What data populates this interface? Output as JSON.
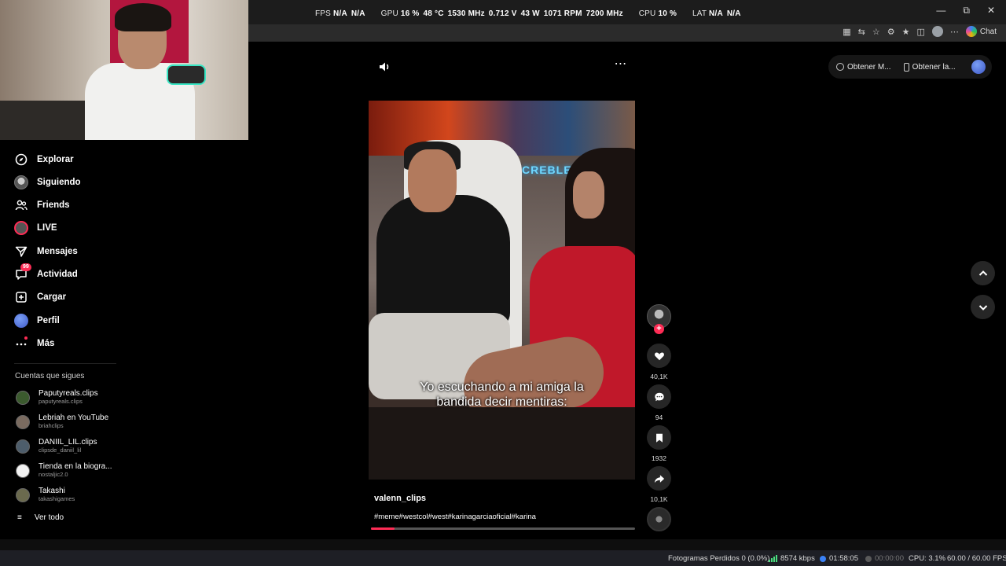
{
  "osd": {
    "fps_label": "FPS",
    "fps_val1": "N/A",
    "fps_val2": "N/A",
    "gpu_label": "GPU",
    "gpu_load": "16 %",
    "gpu_temp": "48 °C",
    "gpu_clock": "1530 MHz",
    "gpu_volt": "0.712 V",
    "gpu_power": "43 W",
    "gpu_fan": "1071 RPM",
    "gpu_mem": "7200 MHz",
    "cpu_label": "CPU",
    "cpu_load": "10 %",
    "lat_label": "LAT",
    "lat_val1": "N/A",
    "lat_val2": "N/A"
  },
  "browser": {
    "chat_label": "Chat"
  },
  "sidebar": {
    "items": [
      {
        "label": "Explorar",
        "icon": "compass-icon"
      },
      {
        "label": "Siguiendo",
        "icon": "following-avatar"
      },
      {
        "label": "Friends",
        "icon": "friends-icon"
      },
      {
        "label": "LIVE",
        "icon": "live-avatar"
      },
      {
        "label": "Mensajes",
        "icon": "send-icon"
      },
      {
        "label": "Actividad",
        "icon": "activity-icon",
        "badge": "99"
      },
      {
        "label": "Cargar",
        "icon": "upload-icon"
      },
      {
        "label": "Perfil",
        "icon": "profile-avatar"
      },
      {
        "label": "Más",
        "icon": "more-icon"
      }
    ],
    "following_title": "Cuentas que sigues",
    "accounts": [
      {
        "name": "Paputyreals.clips",
        "handle": "paputyreals.clips"
      },
      {
        "name": "Lebriah en YouTube",
        "handle": "briahclips"
      },
      {
        "name": "DANIIL_LIL.clips",
        "handle": "clipsde_daniil_lil"
      },
      {
        "name": "Tienda en la biogra...",
        "handle": "nostaljic2.0"
      },
      {
        "name": "Takashi",
        "handle": "takashigames"
      }
    ],
    "see_all": "Ver todo"
  },
  "video": {
    "caption_line1": "Yo escuchando a mi amiga la",
    "caption_line2": "bandida decir mentiras:",
    "neon_text": "CREBLESSD",
    "author": "valenn_clips",
    "tags": "#meme#westcol#west#karinagarciaoficial#karina",
    "progress": 0.09
  },
  "actions": {
    "likes": "40,1K",
    "comments": "94",
    "saves": "1932",
    "shares": "10,1K"
  },
  "right_panel": {
    "pill1": "Obtener M...",
    "pill2": "Obtener la..."
  },
  "statusbar": {
    "dropped": "Fotogramas Perdidos 0 (0.0%)",
    "bitrate": "8574 kbps",
    "stream_time": "01:58:05",
    "rec_time": "00:00:00",
    "cpu": "CPU: 3.1%",
    "fps": "60.00 / 60.00 FPS"
  },
  "colors": {
    "accent": "#fe2c55",
    "bg": "#000000",
    "panel": "#262626"
  }
}
